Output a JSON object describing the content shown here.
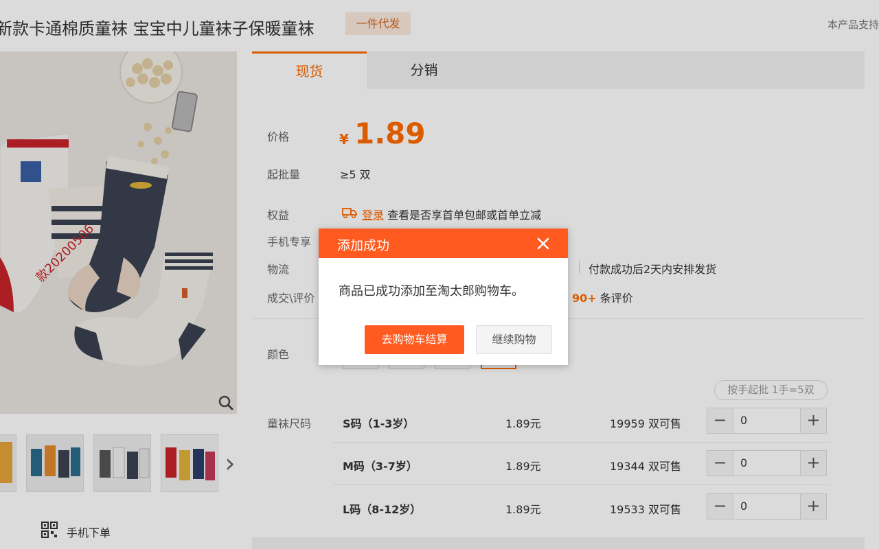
{
  "header": {
    "title": "新款卡通棉质童袜 宝宝中儿童袜子保暖童袜",
    "badge": "一件代发",
    "right_note": "本产品支持"
  },
  "gallery": {
    "watermark": "款20200506",
    "mobile_order_label": "手机下单"
  },
  "tabs": [
    {
      "label": "现货",
      "active": true
    },
    {
      "label": "分销",
      "active": false
    }
  ],
  "info": {
    "price_label": "价格",
    "price_symbol": "¥",
    "price_value": "1.89",
    "moq_label": "起批量",
    "moq_value": "≥5 双",
    "benefit_label": "权益",
    "benefit_link": "登录",
    "benefit_text": "查看是否享首单包邮或首单立减",
    "mobile_label": "手机专享",
    "logistics_label": "物流",
    "logistics_text": "付款成功后2天内安排发货",
    "deals_label": "成交\\评价",
    "reviews_count": "90+",
    "reviews_suffix": "条评价",
    "color_label": "颜色"
  },
  "batch_note": "按手起批 1手=5双",
  "size_table": {
    "label": "童袜尺码",
    "rows": [
      {
        "name": "S码（1-3岁）",
        "price": "1.89元",
        "stock": "19959 双可售",
        "qty": "0"
      },
      {
        "name": "M码（3-7岁）",
        "price": "1.89元",
        "stock": "19344 双可售",
        "qty": "0"
      },
      {
        "name": "L码（8-12岁）",
        "price": "1.89元",
        "stock": "19533 双可售",
        "qty": "0"
      }
    ]
  },
  "dialog": {
    "title": "添加成功",
    "message": "商品已成功添加至淘太郎购物车。",
    "primary_button": "去购物车结算",
    "secondary_button": "继续购物"
  },
  "colors": {
    "accent": "#ff6a00",
    "dialog_accent": "#ff5a1f"
  },
  "icons": {
    "close": "close-icon",
    "zoom": "zoom-icon",
    "next": "chevron-right-icon",
    "qr": "qr-code-icon",
    "truck": "truck-icon"
  }
}
